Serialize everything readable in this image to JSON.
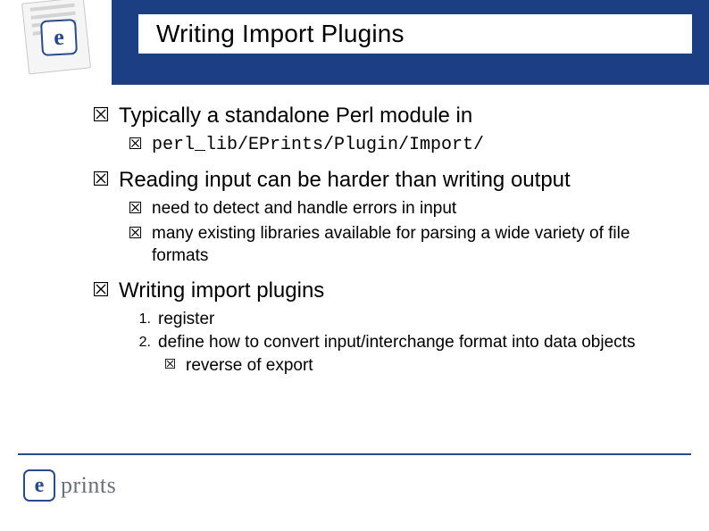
{
  "title": "Writing Import Plugins",
  "bullets": {
    "b1": "Typically a standalone Perl module in",
    "b1a": "perl_lib/EPrints/Plugin/Import/",
    "b2": "Reading input can be harder than writing output",
    "b2a": "need to detect and handle errors in input",
    "b2b": "many existing libraries available for parsing a wide variety of file formats",
    "b3": "Writing import plugins",
    "b3n1_num": "1.",
    "b3n1": "register",
    "b3n2_num": "2.",
    "b3n2": "define how to convert input/interchange format into data objects",
    "b3n2a": "reverse of export"
  },
  "logo": {
    "e": "e",
    "text": "prints"
  }
}
